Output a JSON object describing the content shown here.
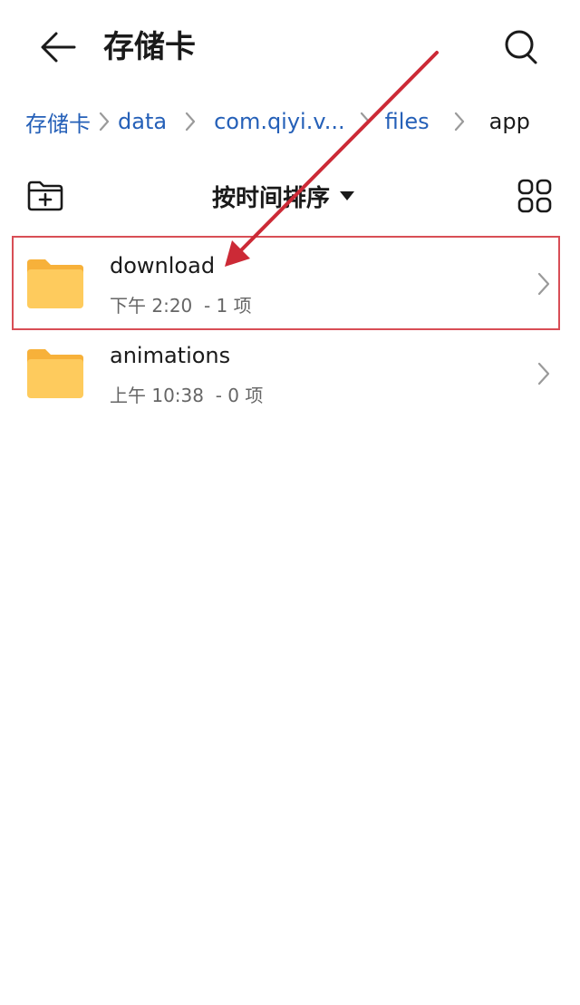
{
  "header": {
    "title": "存储卡",
    "back_icon": "arrow-left-icon",
    "search_icon": "search-icon"
  },
  "breadcrumb": {
    "items": [
      {
        "label": "存储卡"
      },
      {
        "label": "data"
      },
      {
        "label": "com.qiyi.v..."
      },
      {
        "label": "files"
      },
      {
        "label": "app"
      }
    ]
  },
  "toolbar": {
    "new_folder_icon": "folder-plus-icon",
    "sort_label": "按时间排序",
    "view_toggle_icon": "grid-view-icon"
  },
  "files": [
    {
      "name": "download",
      "meta": "下午 2:20  - 1 项",
      "highlighted": true
    },
    {
      "name": "animations",
      "meta": "上午 10:38  - 0 项",
      "highlighted": false
    }
  ],
  "colors": {
    "link": "#2560b8",
    "folder": "#fecb5d",
    "folder_tab": "#f7b13a",
    "highlight": "#d84e56",
    "annotation_arrow": "#cc2a36"
  }
}
